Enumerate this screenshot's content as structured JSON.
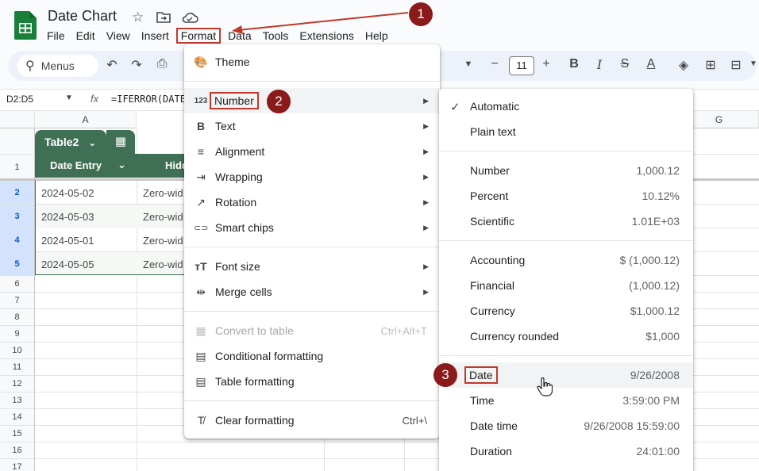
{
  "header": {
    "title": "Date Chart",
    "star_icon": "star-icon",
    "folder_icon": "move-folder-icon",
    "cloud_icon": "cloud-icon"
  },
  "menubar": [
    "File",
    "Edit",
    "View",
    "Insert",
    "Format",
    "Data",
    "Tools",
    "Extensions",
    "Help"
  ],
  "toolbar": {
    "search_label": "Menus",
    "font_size": "11",
    "bold": "B",
    "italic": "I",
    "strike": "S",
    "text_color": "A"
  },
  "formula_bar": {
    "name_box": "D2:D5",
    "fx": "fx",
    "formula": "=IFERROR(DATE"
  },
  "grid": {
    "columns": [
      "A",
      "G"
    ],
    "rows": [
      "1",
      "2",
      "3",
      "4",
      "5",
      "6",
      "7",
      "8",
      "9",
      "10",
      "11",
      "12",
      "13",
      "14",
      "15",
      "16",
      "17"
    ],
    "table_name": "Table2",
    "headers": [
      "Date Entry",
      "Hidd"
    ],
    "data": [
      [
        "2024-05-02",
        "Zero-wid"
      ],
      [
        "2024-05-03",
        "Zero-wid"
      ],
      [
        "2024-05-01",
        "Zero-wid"
      ],
      [
        "2024-05-05",
        "Zero-wid"
      ]
    ]
  },
  "format_menu": {
    "items": [
      {
        "label": "Theme",
        "icon": "palette-icon",
        "glyph": "🎨"
      },
      {
        "label": "Number",
        "icon": "number-format-icon",
        "glyph": "123"
      },
      {
        "label": "Text",
        "icon": "bold-text-icon",
        "glyph": "B"
      },
      {
        "label": "Alignment",
        "icon": "align-icon",
        "glyph": "≡"
      },
      {
        "label": "Wrapping",
        "icon": "wrap-icon",
        "glyph": "⇥"
      },
      {
        "label": "Rotation",
        "icon": "rotation-icon",
        "glyph": "↗"
      },
      {
        "label": "Smart chips",
        "icon": "smart-chip-icon",
        "glyph": "⊂⊃"
      },
      {
        "label": "Font size",
        "icon": "font-size-icon",
        "glyph": "тT"
      },
      {
        "label": "Merge cells",
        "icon": "merge-icon",
        "glyph": "⇹"
      },
      {
        "label": "Convert to table",
        "icon": "table-icon",
        "glyph": "▦",
        "shortcut": "Ctrl+Alt+T"
      },
      {
        "label": "Conditional formatting",
        "icon": "paint-roller-icon",
        "glyph": "▤"
      },
      {
        "label": "Table formatting",
        "icon": "paint-roller-icon",
        "glyph": "▤"
      },
      {
        "label": "Clear formatting",
        "icon": "clear-format-icon",
        "glyph": "T̸",
        "shortcut": "Ctrl+\\"
      }
    ]
  },
  "number_menu": {
    "items": [
      {
        "label": "Automatic",
        "value": ""
      },
      {
        "label": "Plain text",
        "value": ""
      },
      {
        "label": "Number",
        "value": "1,000.12"
      },
      {
        "label": "Percent",
        "value": "10.12%"
      },
      {
        "label": "Scientific",
        "value": "1.01E+03"
      },
      {
        "label": "Accounting",
        "value": "$ (1,000.12)"
      },
      {
        "label": "Financial",
        "value": "(1,000.12)"
      },
      {
        "label": "Currency",
        "value": "$1,000.12"
      },
      {
        "label": "Currency rounded",
        "value": "$1,000"
      },
      {
        "label": "Date",
        "value": "9/26/2008"
      },
      {
        "label": "Time",
        "value": "3:59:00 PM"
      },
      {
        "label": "Date time",
        "value": "9/26/2008 15:59:00"
      },
      {
        "label": "Duration",
        "value": "24:01:00"
      }
    ]
  },
  "callouts": [
    "1",
    "2",
    "3"
  ],
  "colors": {
    "callout": "#8b1a1a",
    "highlight_box": "#c0392b",
    "table_green": "#3f6f54",
    "selected_row": "#d3e3fd"
  }
}
